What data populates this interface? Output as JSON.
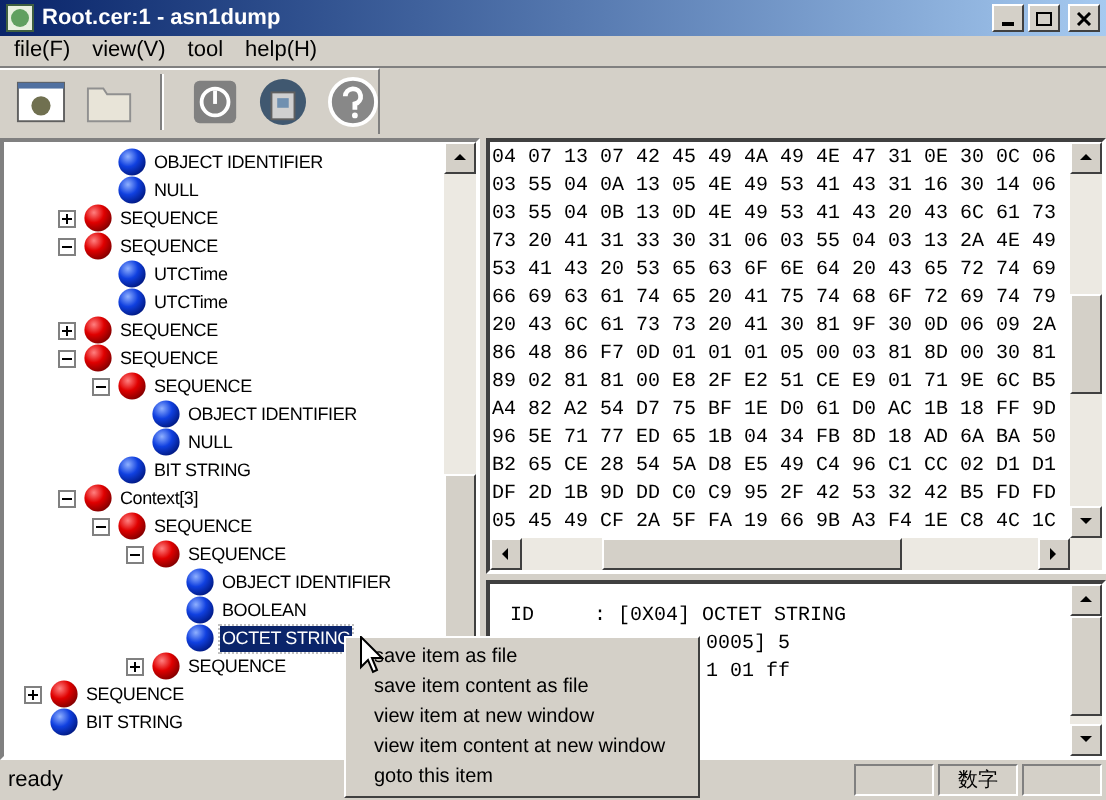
{
  "window": {
    "title": "Root.cer:1 - asn1dump"
  },
  "menu": [
    "file(F)",
    "view(V)",
    "tool",
    "help(H)"
  ],
  "toolbar": [
    {
      "kind": "window"
    },
    {
      "kind": "folder"
    },
    {
      "kind": "sep"
    },
    {
      "kind": "power"
    },
    {
      "kind": "disk"
    },
    {
      "kind": "help"
    }
  ],
  "tree": [
    {
      "children": [
        {
          "children": [
            {
              "label": "OBJECT IDENTIFIER",
              "kind": "primitive",
              "selected": false
            },
            {
              "label": "NULL",
              "kind": "primitive",
              "selected": false
            }
          ]
        },
        {
          "label": "SEQUENCE",
          "kind": "constructed",
          "expanded": false,
          "selected": false
        },
        {
          "label": "SEQUENCE",
          "kind": "constructed",
          "expanded": true,
          "selected": false,
          "children": [
            {
              "label": "UTCTime",
              "kind": "primitive",
              "selected": false
            },
            {
              "label": "UTCTime",
              "kind": "primitive",
              "selected": false
            }
          ]
        },
        {
          "label": "SEQUENCE",
          "kind": "constructed",
          "expanded": false,
          "selected": false
        },
        {
          "label": "SEQUENCE",
          "kind": "constructed",
          "expanded": true,
          "selected": false,
          "children": [
            {
              "label": "SEQUENCE",
              "kind": "constructed",
              "expanded": true,
              "selected": false,
              "children": [
                {
                  "label": "OBJECT IDENTIFIER",
                  "kind": "primitive",
                  "selected": false
                },
                {
                  "label": "NULL",
                  "kind": "primitive",
                  "selected": false
                }
              ]
            },
            {
              "label": "BIT STRING",
              "kind": "primitive",
              "selected": false
            }
          ]
        },
        {
          "label": "Context[3]",
          "kind": "constructed",
          "expanded": true,
          "selected": false,
          "children": [
            {
              "label": "SEQUENCE",
              "kind": "constructed",
              "expanded": true,
              "selected": false,
              "children": [
                {
                  "label": "SEQUENCE",
                  "kind": "constructed",
                  "expanded": true,
                  "selected": false,
                  "children": [
                    {
                      "label": "OBJECT IDENTIFIER",
                      "kind": "primitive",
                      "selected": false
                    },
                    {
                      "label": "BOOLEAN",
                      "kind": "primitive",
                      "selected": false
                    },
                    {
                      "label": "OCTET STRING",
                      "kind": "primitive",
                      "selected": true
                    }
                  ]
                },
                {
                  "label": "SEQUENCE",
                  "kind": "constructed",
                  "expanded": false,
                  "selected": false
                }
              ]
            }
          ]
        }
      ]
    },
    {
      "label": "SEQUENCE",
      "kind": "constructed",
      "expanded": false,
      "selected": false
    },
    {
      "label": "BIT STRING",
      "kind": "primitive",
      "selected": false
    }
  ],
  "hex": [
    "04 07 13 07 42 45 49 4A 49 4E 47 31 0E 30 0C 06",
    "03 55 04 0A 13 05 4E 49 53 41 43 31 16 30 14 06",
    "03 55 04 0B 13 0D 4E 49 53 41 43 20 43 6C 61 73",
    "73 20 41 31 33 30 31 06 03 55 04 03 13 2A 4E 49",
    "53 41 43 20 53 65 63 6F 6E 64 20 43 65 72 74 69",
    "66 69 63 61 74 65 20 41 75 74 68 6F 72 69 74 79",
    "20 43 6C 61 73 73 20 41 30 81 9F 30 0D 06 09 2A",
    "86 48 86 F7 0D 01 01 01 05 00 03 81 8D 00 30 81",
    "89 02 81 81 00 E8 2F E2 51 CE E9 01 71 9E 6C B5",
    "A4 82 A2 54 D7 75 BF 1E D0 61 D0 AC 1B 18 FF 9D",
    "96 5E 71 77 ED 65 1B 04 34 FB 8D 18 AD 6A BA 50",
    "B2 65 CE 28 54 5A D8 E5 49 C4 96 C1 CC 02 D1 D1",
    "DF 2D 1B 9D DD C0 C9 95 2F 42 53 32 42 B5 FD FD",
    "05 45 49 CF 2A 5F FA 19 66 9B A3 F4 1E C8 4C 1C"
  ],
  "detail": [
    "ID     : [0X04] OCTET STRING",
    "0005] 5",
    "1 01 ff"
  ],
  "context_menu": [
    "save item as file",
    "save item content as file",
    "view item at new window",
    "view item content at new window",
    "goto this item"
  ],
  "status_bar": {
    "text": "ready",
    "indicator": "数字"
  }
}
